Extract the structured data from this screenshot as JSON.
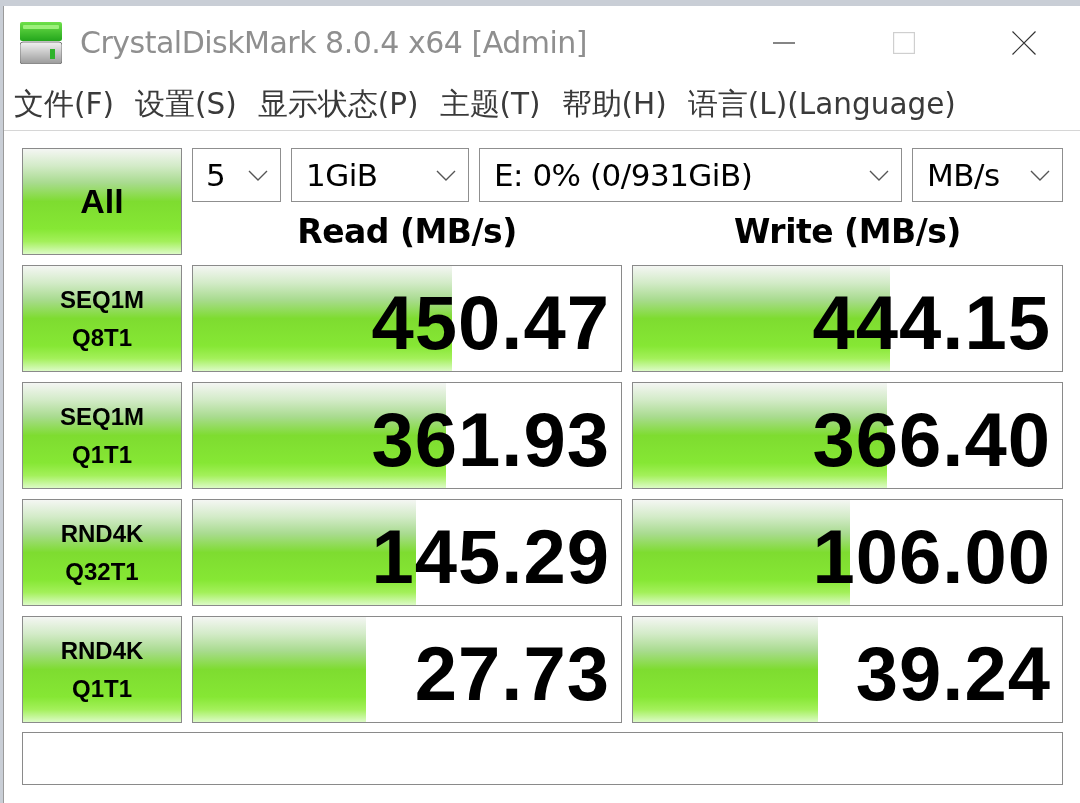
{
  "window": {
    "title": "CrystalDiskMark 8.0.4 x64 [Admin]",
    "active": false,
    "maximize_disabled": true
  },
  "menu": [
    "文件(F)",
    "设置(S)",
    "显示状态(P)",
    "主题(T)",
    "帮助(H)",
    "语言(L)(Language)"
  ],
  "toolbar": {
    "all_button": "All",
    "selects": [
      {
        "value": "5"
      },
      {
        "value": "1GiB"
      },
      {
        "value": "E: 0% (0/931GiB)"
      },
      {
        "value": "MB/s"
      }
    ]
  },
  "columns": [
    "Read (MB/s)",
    "Write (MB/s)"
  ],
  "tests": [
    {
      "label": [
        "SEQ1M",
        "Q8T1"
      ],
      "read": {
        "value": "450.47",
        "level": 0.605
      },
      "write": {
        "value": "444.15",
        "level": 0.598
      }
    },
    {
      "label": [
        "SEQ1M",
        "Q1T1"
      ],
      "read": {
        "value": "361.93",
        "level": 0.59
      },
      "write": {
        "value": "366.40",
        "level": 0.593
      }
    },
    {
      "label": [
        "RND4K",
        "Q32T1"
      ],
      "read": {
        "value": "145.29",
        "level": 0.522
      },
      "write": {
        "value": "106.00",
        "level": 0.505
      }
    },
    {
      "label": [
        "RND4K",
        "Q1T1"
      ],
      "read": {
        "value": "27.73",
        "level": 0.405
      },
      "write": {
        "value": "39.24",
        "level": 0.431
      }
    }
  ]
}
